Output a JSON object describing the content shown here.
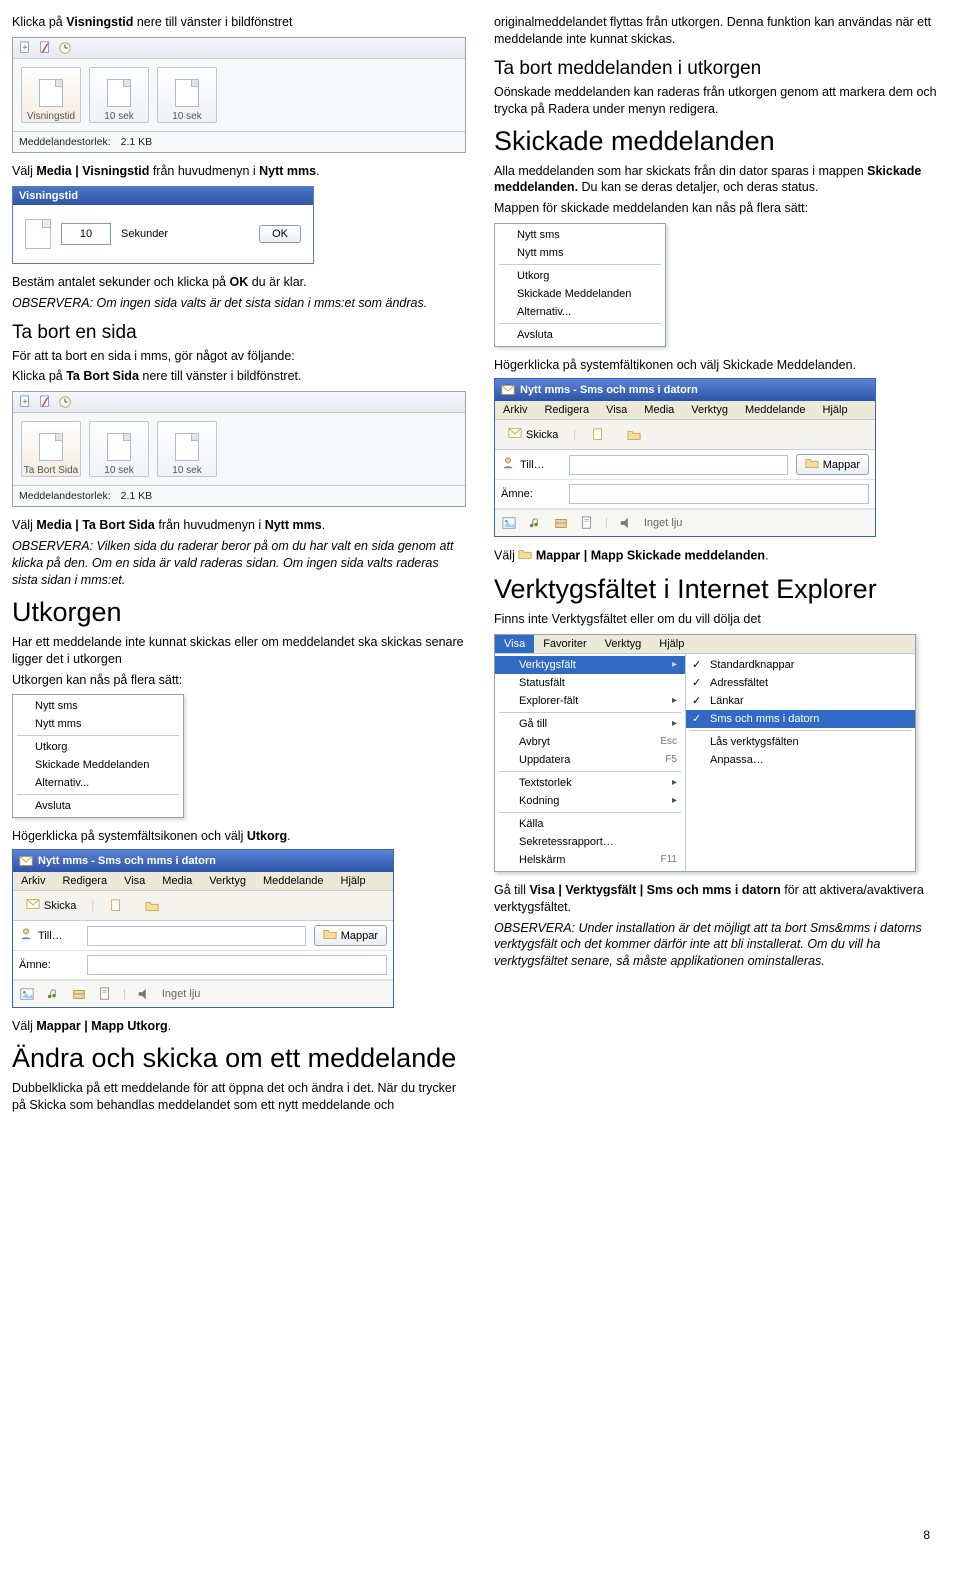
{
  "left": {
    "p1_pre": "Klicka på ",
    "p1_b": "Visningstid",
    "p1_post": " nere till vänster i bildfönstret",
    "fig1": {
      "btnLabel": "Visningstid",
      "thumb1": "10 sek",
      "thumb2": "10 sek",
      "statusLabel": "Meddelandestorlek:",
      "statusValue": "2.1 KB"
    },
    "p2_pre": "Välj ",
    "p2_b1": "Media | Visningstid",
    "p2_mid": " från huvudmenyn i ",
    "p2_b2": "Nytt mms",
    "p2_post": ".",
    "dlg": {
      "title": "Visningstid",
      "value": "10",
      "unit": "Sekunder",
      "ok": "OK"
    },
    "p3_pre": "Bestäm antalet sekunder och klicka på ",
    "p3_b": "OK",
    "p3_post": " du är klar.",
    "p4": "OBSERVERA: Om ingen sida valts är det sista sidan i mms:et som ändras.",
    "h2a": "Ta bort en sida",
    "p5": "För att ta bort en sida i mms, gör något av följande:",
    "p6_pre": "Klicka på ",
    "p6_b": "Ta Bort Sida",
    "p6_post": " nere till vänster i bildfönstret.",
    "fig2": {
      "btnLabel": "Ta Bort Sida",
      "thumb1": "10 sek",
      "thumb2": "10 sek",
      "statusLabel": "Meddelandestorlek:",
      "statusValue": "2.1 KB"
    },
    "p7_pre": "Välj ",
    "p7_b": "Media | Ta Bort Sida",
    "p7_mid": " från huvudmenyn i ",
    "p7_b2": "Nytt mms",
    "p7_post": ".",
    "p8": "OBSERVERA: Vilken sida du raderar beror på om du har valt en sida genom att klicka på den. Om en sida är vald raderas sidan. Om ingen sida valts raderas sista sidan i mms:et.",
    "h1a": "Utkorgen",
    "p9": "Har ett meddelande inte kunnat skickas eller om meddelandet ska skickas senare ligger det i utkorgen",
    "p10": "Utkorgen kan nås på flera sätt:",
    "ctx1": {
      "i1": "Nytt sms",
      "i2": "Nytt mms",
      "i3": "Utkorg",
      "i4": "Skickade Meddelanden",
      "i5": "Alternativ...",
      "i6": "Avsluta"
    },
    "p11_pre": "Högerklicka på systemfältsikonen och välj ",
    "p11_b": "Utkorg",
    "p11_post": ".",
    "win1": {
      "title": "Nytt mms - Sms och mms i datorn",
      "menu": [
        "Arkiv",
        "Redigera",
        "Visa",
        "Media",
        "Verktyg",
        "Meddelande",
        "Hjälp"
      ],
      "skicka": "Skicka",
      "till": "Till…",
      "amne": "Ämne:",
      "mappar": "Mappar",
      "inget": "Inget lju"
    },
    "p12_pre": "Välj ",
    "p12_b": "Mappar | Mapp Utkorg",
    "p12_post": ".",
    "h1b": "Ändra och skicka om ett meddelande",
    "p13": "Dubbelklicka på ett meddelande för att öppna det och ändra i det. När du trycker på Skicka som behandlas meddelandet som ett nytt meddelande och"
  },
  "right": {
    "p1": "originalmeddelandet flyttas från utkorgen. Denna funktion kan användas när ett meddelande inte kunnat skickas.",
    "h2a": "Ta bort meddelanden i utkorgen",
    "p2": "Oönskade meddelanden kan raderas från utkorgen genom att markera dem och trycka på Radera under menyn redigera.",
    "h1a": "Skickade meddelanden",
    "p3_pre": "Alla meddelanden som har skickats från din dator sparas i mappen ",
    "p3_b": "Skickade meddelanden.",
    "p3_post": " Du kan se deras detaljer, och deras status.",
    "p4": "Mappen för skickade meddelanden kan nås på flera sätt:",
    "ctx1": {
      "i1": "Nytt sms",
      "i2": "Nytt mms",
      "i3": "Utkorg",
      "i4": "Skickade Meddelanden",
      "i5": "Alternativ...",
      "i6": "Avsluta"
    },
    "p5": "Högerklicka på systemfältikonen och välj Skickade Meddelanden.",
    "win1": {
      "title": "Nytt mms - Sms och mms i datorn",
      "menu": [
        "Arkiv",
        "Redigera",
        "Visa",
        "Media",
        "Verktyg",
        "Meddelande",
        "Hjälp"
      ],
      "skicka": "Skicka",
      "till": "Till…",
      "amne": "Ämne:",
      "mappar": "Mappar",
      "inget": "Inget lju"
    },
    "p6_pre": "Välj ",
    "p6_b": " Mappar | Mapp Skickade meddelanden",
    "p6_post": ".",
    "h1b": "Verktygsfältet i Internet Explorer",
    "p7": "Finns inte Verktygsfältet eller om du vill dölja det",
    "ie": {
      "bar": [
        "Visa",
        "Favoriter",
        "Verktyg",
        "Hjälp"
      ],
      "left": [
        {
          "t": "Verktygsfält",
          "arrow": true,
          "sel": true
        },
        {
          "t": "Statusfält"
        },
        {
          "t": "Explorer-fält",
          "arrow": true
        },
        {
          "sep": true
        },
        {
          "t": "Gå till",
          "arrow": true
        },
        {
          "t": "Avbryt",
          "kb": "Esc"
        },
        {
          "t": "Uppdatera",
          "kb": "F5"
        },
        {
          "sep": true
        },
        {
          "t": "Textstorlek",
          "arrow": true
        },
        {
          "t": "Kodning",
          "arrow": true
        },
        {
          "sep": true
        },
        {
          "t": "Källa"
        },
        {
          "t": "Sekretessrapport…"
        },
        {
          "t": "Helskärm",
          "kb": "F11"
        }
      ],
      "right": [
        {
          "t": "Standardknappar",
          "chk": true
        },
        {
          "t": "Adressfältet",
          "chk": true
        },
        {
          "t": "Länkar",
          "chk": true
        },
        {
          "t": "Sms och mms i datorn",
          "chk": true,
          "sel": true
        },
        {
          "sep": true
        },
        {
          "t": "Lås verktygsfälten"
        },
        {
          "t": "Anpassa…"
        }
      ]
    },
    "p8_pre": "Gå till ",
    "p8_b": "Visa | Verktygsfält | Sms och mms i datorn",
    "p8_post": " för att aktivera/avaktivera verktygsfältet.",
    "p9": "OBSERVERA: Under installation är det möjligt att ta bort Sms&mms i datorns verktygsfält och det kommer därför inte att bli installerat. Om du vill ha verktygsfältet senare, så måste applikationen ominstalleras."
  },
  "pagenum": "8"
}
